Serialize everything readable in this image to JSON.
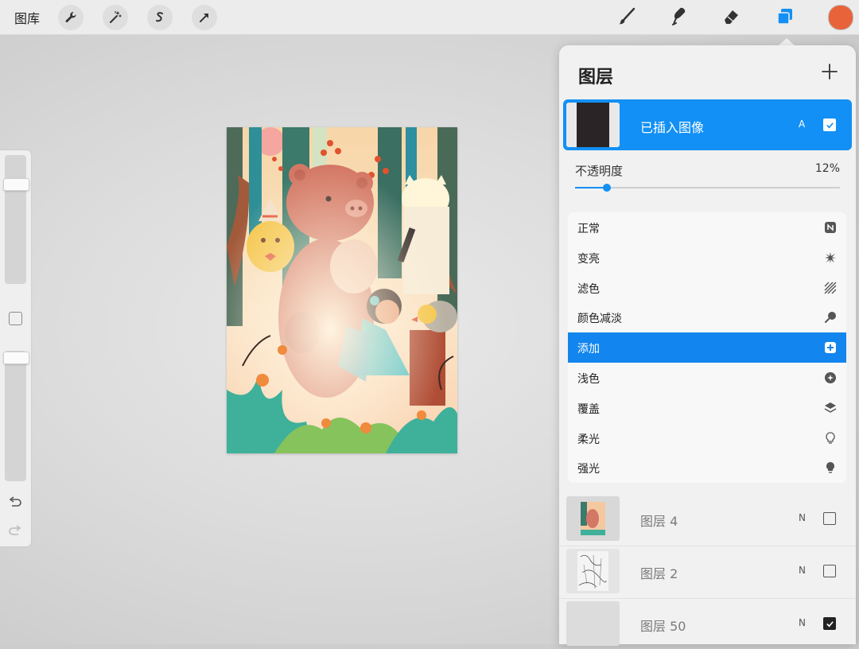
{
  "toolbar": {
    "gallery_label": "图库",
    "left_tools": [
      "wrench-icon",
      "magic-wand-icon",
      "selection-icon",
      "transform-arrow-icon"
    ],
    "right_tools": [
      "brush-icon",
      "smudge-icon",
      "eraser-icon",
      "layers-icon"
    ],
    "current_color": "#e8633a"
  },
  "sidebar": {
    "brush_size_level": 0.9,
    "opacity_level": 0.95
  },
  "layers_panel": {
    "title": "图层",
    "active_layer": {
      "name": "已插入图像",
      "mode_letter": "A",
      "visible": true
    },
    "opacity": {
      "label": "不透明度",
      "value_text": "12%",
      "value": 0.12
    },
    "blend_modes": [
      {
        "label": "正常",
        "icon": "n-badge-icon",
        "selected": false
      },
      {
        "label": "变亮",
        "icon": "starburst-icon",
        "selected": false
      },
      {
        "label": "滤色",
        "icon": "diagonal-lines-icon",
        "selected": false
      },
      {
        "label": "颜色减淡",
        "icon": "dodge-wand-icon",
        "selected": false
      },
      {
        "label": "添加",
        "icon": "plus-square-icon",
        "selected": true
      },
      {
        "label": "浅色",
        "icon": "lighter-color-icon",
        "selected": false
      },
      {
        "label": "覆盖",
        "icon": "stacked-layers-icon",
        "selected": false
      },
      {
        "label": "柔光",
        "icon": "bulb-outline-icon",
        "selected": false
      },
      {
        "label": "强光",
        "icon": "bulb-filled-icon",
        "selected": false
      }
    ],
    "layers": [
      {
        "name": "图层 4",
        "mode_letter": "N",
        "visible": false
      },
      {
        "name": "图层 2",
        "mode_letter": "N",
        "visible": false
      },
      {
        "name": "图层 50",
        "mode_letter": "N",
        "visible": true
      }
    ]
  },
  "colors": {
    "accent": "#1290f5",
    "swatch": "#e8633a"
  }
}
